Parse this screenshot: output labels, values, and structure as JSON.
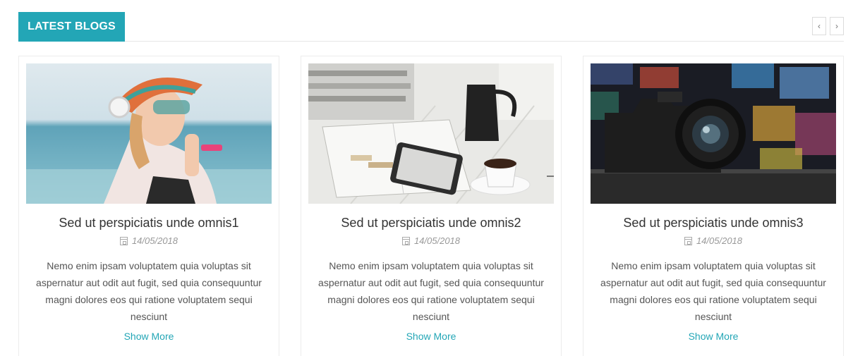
{
  "section": {
    "title": "LATEST BLOGS",
    "prev_icon": "chevron-left-icon",
    "next_icon": "chevron-right-icon",
    "prev_glyph": "‹",
    "next_glyph": "›",
    "accent_color": "#23a6b6"
  },
  "posts": [
    {
      "title": "Sed ut perspiciatis unde omnis1",
      "date": "14/05/2018",
      "excerpt": "Nemo enim ipsam voluptatem quia voluptas sit aspernatur aut odit aut fugit, sed quia consequuntur magni dolores eos qui ratione voluptatem sequi nesciunt",
      "more_label": "Show More",
      "image": "woman-with-headphones-beach"
    },
    {
      "title": "Sed ut perspiciatis unde omnis2",
      "date": "14/05/2018",
      "excerpt": "Nemo enim ipsam voluptatem quia voluptas sit aspernatur aut odit aut fugit, sed quia consequuntur magni dolores eos qui ratione voluptatem sequi nesciunt",
      "more_label": "Show More",
      "image": "desk-with-coffee-and-tablet"
    },
    {
      "title": "Sed ut perspiciatis unde omnis3",
      "date": "14/05/2018",
      "excerpt": "Nemo enim ipsam voluptatem quia voluptas sit aspernatur aut odit aut fugit, sed quia consequuntur magni dolores eos qui ratione voluptatem sequi nesciunt",
      "more_label": "Show More",
      "image": "camera-in-front-of-screens"
    }
  ]
}
